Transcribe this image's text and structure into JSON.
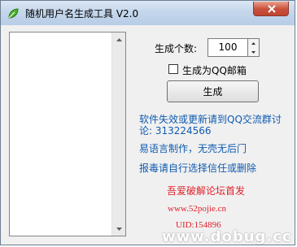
{
  "window": {
    "title": "随机用户名生成工具 V2.0"
  },
  "controls": {
    "count_label": "生成个数:",
    "count_value": "100",
    "qq_mail_checkbox_label": "生成为QQ邮箱",
    "generate_button": "生成"
  },
  "info": {
    "line1": "软件失效或更新请到QQ交流群讨",
    "line2": "论: 313224566",
    "line3": "易语言制作，无壳无后门",
    "line4": "报毒请自行选择信任或删除"
  },
  "footer": {
    "release_note": "吾爱破解论坛首发",
    "website": "www.52pojie.cn",
    "uid": "UID:154896"
  },
  "watermark": "www.dobug.cc",
  "colors": {
    "info_blue": "#0f5bb0",
    "promo_red": "#e0202a",
    "titlebar": "#c5d7ec"
  }
}
